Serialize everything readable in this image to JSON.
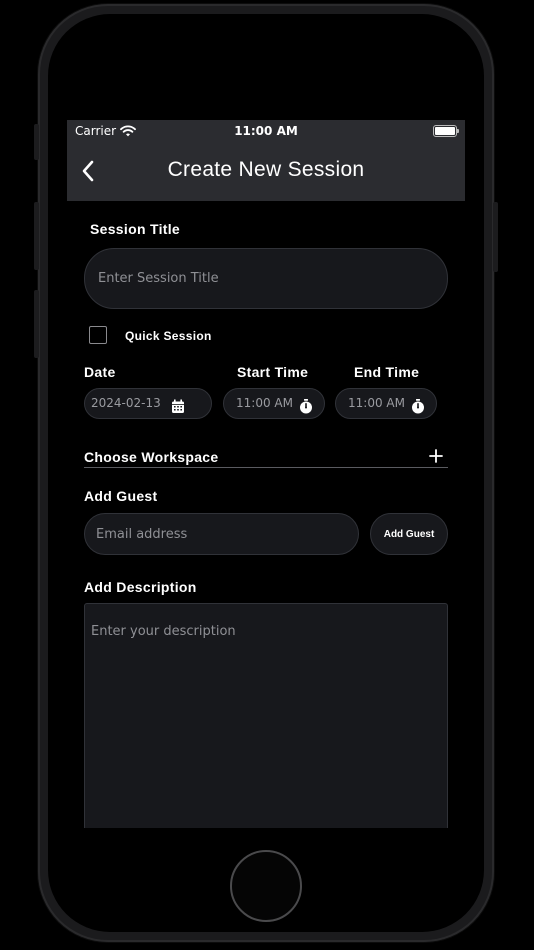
{
  "status_bar": {
    "carrier": "Carrier",
    "time": "11:00 AM"
  },
  "nav": {
    "title": "Create New Session"
  },
  "form": {
    "session_title_label": "Session Title",
    "session_title_placeholder": "Enter Session Title",
    "quick_session_label": "Quick Session",
    "quick_session_checked": false,
    "date_label": "Date",
    "date_value": "2024-02-13",
    "start_time_label": "Start Time",
    "start_time_value": "11:00 AM",
    "end_time_label": "End Time",
    "end_time_value": "11:00 AM",
    "workspace_label": "Choose Workspace",
    "guest_label": "Add Guest",
    "guest_email_placeholder": "Email address",
    "add_guest_button": "Add Guest",
    "description_label": "Add Description",
    "description_placeholder": "Enter your description"
  },
  "icons": {
    "back": "chevron-left-icon",
    "wifi": "wifi-icon",
    "battery": "battery-icon",
    "calendar": "calendar-icon",
    "stopwatch": "stopwatch-icon",
    "add_workspace": "plus-icon"
  },
  "colors": {
    "background": "#000000",
    "bar": "#2b2c30",
    "field": "#17181c",
    "field_border": "#303238",
    "text": "#ffffff",
    "placeholder": "#8f9095"
  }
}
